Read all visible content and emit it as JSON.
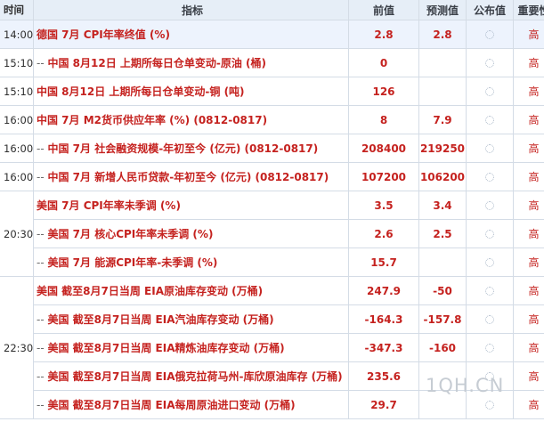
{
  "header": {
    "time": "时间",
    "indicator": "指标",
    "previous": "前值",
    "forecast": "预测值",
    "published": "公布值",
    "importance": "重要性"
  },
  "rows": [
    {
      "time": "14:00",
      "prefix": "",
      "name": "德国 7月 CPI年率终值 (%)",
      "previous": "2.8",
      "forecast": "2.8",
      "importance": "高"
    },
    {
      "time": "15:10",
      "prefix": "-- ",
      "name": "中国 8月12日 上期所每日仓单变动-原油 (桶)",
      "previous": "0",
      "forecast": "",
      "importance": "高"
    },
    {
      "time": "15:10",
      "prefix": "",
      "name": "中国 8月12日 上期所每日仓单变动-铜 (吨)",
      "previous": "126",
      "forecast": "",
      "importance": "高"
    },
    {
      "time": "16:00",
      "prefix": "",
      "name": "中国 7月 M2货币供应年率 (%) (0812-0817)",
      "previous": "8",
      "forecast": "7.9",
      "importance": "高"
    },
    {
      "time": "16:00",
      "prefix": "-- ",
      "name": "中国 7月 社会融资规模-年初至今 (亿元) (0812-0817)",
      "previous": "208400",
      "forecast": "219250",
      "importance": "高"
    },
    {
      "time": "16:00",
      "prefix": "-- ",
      "name": "中国 7月 新增人民币贷款-年初至今 (亿元) (0812-0817)",
      "previous": "107200",
      "forecast": "106200",
      "importance": "高"
    },
    {
      "time": "",
      "prefix": "",
      "name": "美国 7月 CPI年率未季调 (%)",
      "previous": "3.5",
      "forecast": "3.4",
      "importance": "高"
    },
    {
      "time": "20:30",
      "prefix": "-- ",
      "name": "美国 7月 核心CPI年率未季调 (%)",
      "previous": "2.6",
      "forecast": "2.5",
      "importance": "高"
    },
    {
      "time": "",
      "prefix": "-- ",
      "name": "美国 7月 能源CPI年率-未季调 (%)",
      "previous": "15.7",
      "forecast": "",
      "importance": "高"
    },
    {
      "time": "",
      "prefix": "",
      "name": "美国 截至8月7日当周 EIA原油库存变动 (万桶)",
      "previous": "247.9",
      "forecast": "-50",
      "importance": "高"
    },
    {
      "time": "",
      "prefix": "-- ",
      "name": "美国 截至8月7日当周 EIA汽油库存变动 (万桶)",
      "previous": "-164.3",
      "forecast": "-157.8",
      "importance": "高"
    },
    {
      "time": "22:30",
      "prefix": "-- ",
      "name": "美国 截至8月7日当周 EIA精炼油库存变动 (万桶)",
      "previous": "-347.3",
      "forecast": "-160",
      "importance": "高"
    },
    {
      "time": "",
      "prefix": "-- ",
      "name": "美国 截至8月7日当周 EIA俄克拉荷马州-库欣原油库存 (万桶)",
      "previous": "235.6",
      "forecast": "",
      "importance": "高"
    },
    {
      "time": "",
      "prefix": "-- ",
      "name": "美国 截至8月7日当周 EIA每周原油进口变动 (万桶)",
      "previous": "29.7",
      "forecast": "",
      "importance": "高"
    }
  ],
  "watermark": "1QH.CN",
  "icons": {
    "published": "loading-spinner-icon"
  }
}
